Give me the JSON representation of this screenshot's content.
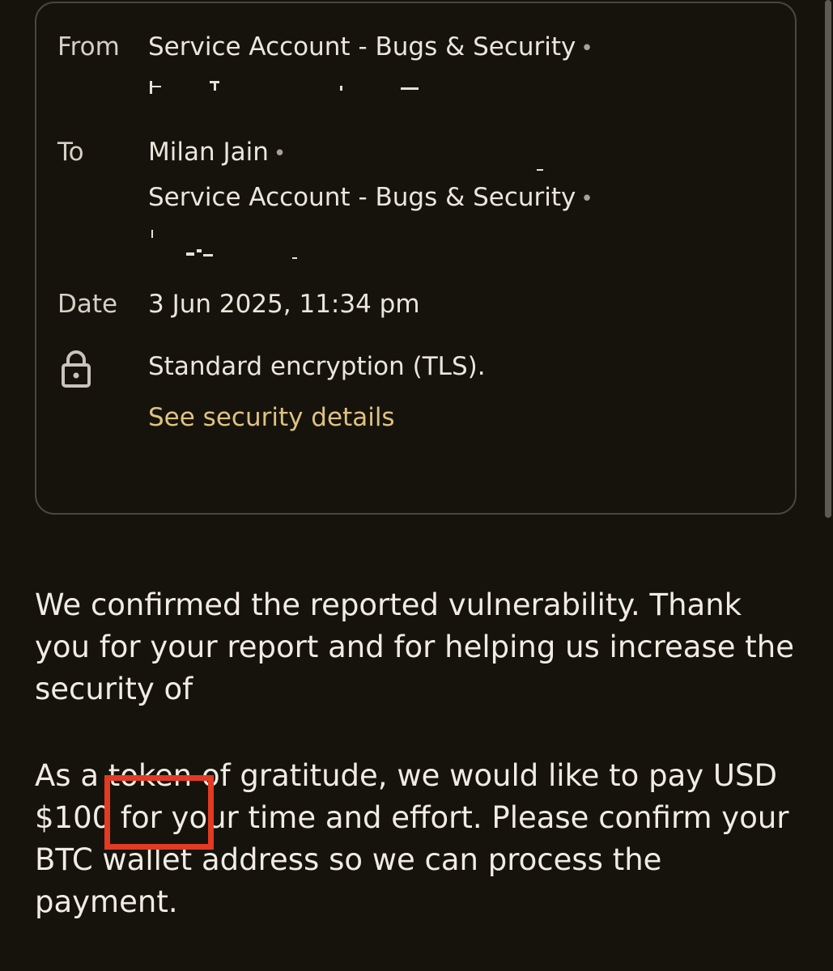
{
  "header": {
    "from_label": "From",
    "from_sender": "Service Account - Bugs & Security",
    "to_label": "To",
    "to_recipient_1": "Milan Jain",
    "to_recipient_2": "Service Account - Bugs & Security",
    "date_label": "Date",
    "date_value": "3 Jun 2025, 11:34 pm",
    "encryption_text": "Standard encryption (TLS).",
    "security_link": "See security details",
    "separator": "•"
  },
  "body": {
    "paragraph_1": "We confirmed the reported vulnerability. Thank you for your report and for helping us increase the security of",
    "paragraph_2": "As a token of gratitude, we would like to pay USD $100 for your time and effort. Please confirm your BTC wallet address so we can process the payment.",
    "highlighted_amount": "$100"
  },
  "colors": {
    "background": "#16130d",
    "text": "#ebe6dc",
    "link": "#dfc27f",
    "highlight_box": "#e33a24",
    "card_border": "#4b463c"
  },
  "icons": {
    "encryption": "lock-icon"
  }
}
